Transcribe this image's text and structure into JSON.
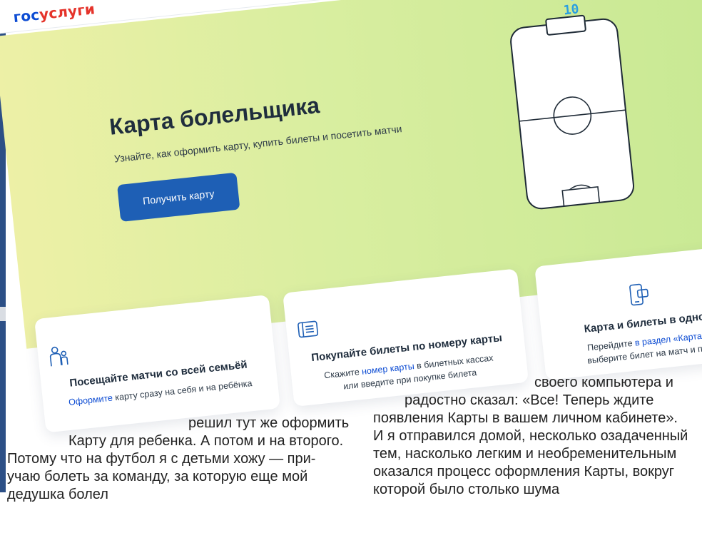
{
  "logo": {
    "part1": "гос",
    "part2": "услуги"
  },
  "hero": {
    "title": "Карта болельщика",
    "subtitle": "Узнайте, как оформить карту, купить билеты и посетить матчи",
    "button_label": "Получить карту"
  },
  "features": [
    {
      "title": "Посещайте матчи со всей семьёй",
      "text_link": "Оформите",
      "text_rest": " карту сразу на себя и на ребёнка",
      "icon": "family-icon"
    },
    {
      "title": "Покупайте билеты по номеру карты",
      "text_prefix": "Скажите ",
      "text_link": "номер карты",
      "text_rest": " в билетных кассах",
      "text_line2": "или введите при покупке билета",
      "icon": "card-list-icon"
    },
    {
      "title": "Карта и билеты в одном мес",
      "text_prefix": "Перейдите ",
      "text_link": "в раздел «Карта болель",
      "text_line2": "выберите билет на матч и покажите",
      "icon": "phone-card-icon"
    }
  ],
  "article": {
    "right_lines": [
      "своего компьютера и",
      "радостно сказал: «Все! Теперь ждите",
      "появления Карты в вашем личном кабинете».",
      "И я отправился домой, несколько озадаченный",
      "тем, насколько легким и необременительным",
      "оказался процесс оформления Карты, вокруг",
      "которой было столько шума"
    ],
    "left_lines": [
      "решил тут же оформить",
      "Карту для ребенка. А потом и на второго.",
      "Потому что на футбол я с детьми хожу — при-",
      "учаю болеть за команду, за которую еще мой",
      "дедушка болел"
    ]
  },
  "colors": {
    "brand_blue": "#0d4cd3",
    "brand_red": "#e5332a",
    "button": "#1e5fb5",
    "hero_start": "#edf0a6",
    "hero_end": "#c6e892"
  }
}
